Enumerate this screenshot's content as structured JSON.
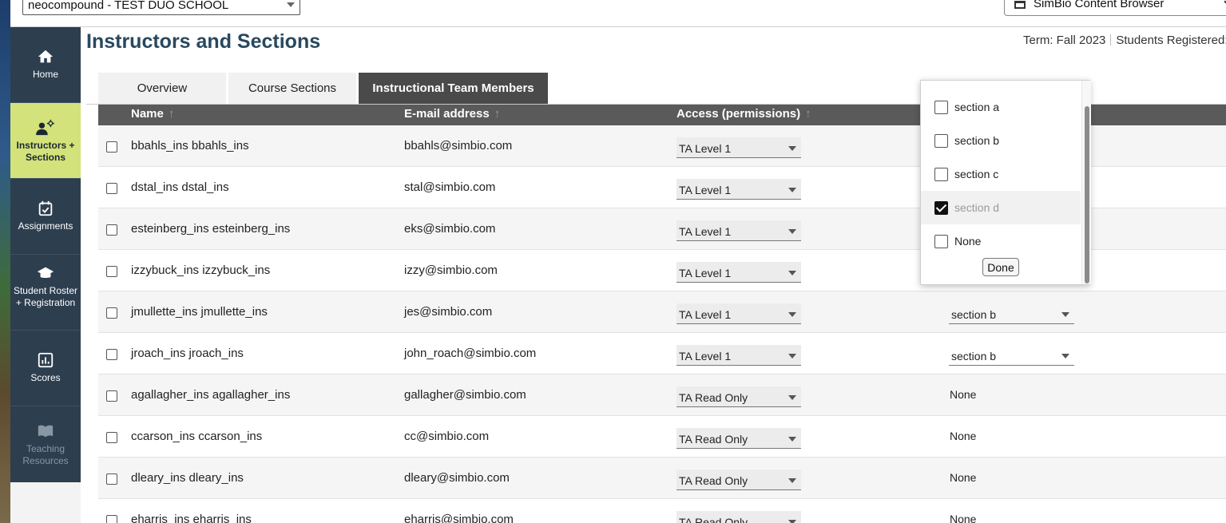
{
  "topbar": {
    "school": "neocompound - TEST DUO SCHOOL",
    "content_browser": "SimBio Content Browser"
  },
  "sidebar": {
    "items": [
      {
        "label": "Home",
        "icon": "home-icon"
      },
      {
        "label": "Instructors + Sections",
        "icon": "instructors-icon"
      },
      {
        "label": "Assignments",
        "icon": "calendar-check-icon"
      },
      {
        "label": "Student Roster + Registration",
        "icon": "graduation-cap-icon"
      },
      {
        "label": "Scores",
        "icon": "bar-chart-icon"
      },
      {
        "label": "Teaching Resources",
        "icon": "book-icon"
      }
    ]
  },
  "header": {
    "title": "Instructors and Sections",
    "term": "Term: Fall 2023",
    "students_registered": "Students Registered:"
  },
  "tabs": [
    {
      "label": "Overview"
    },
    {
      "label": "Course Sections"
    },
    {
      "label": "Instructional Team Members"
    }
  ],
  "table": {
    "columns": [
      "Name",
      "E-mail address",
      "Access (permissions)"
    ],
    "sort_arrow": "↑",
    "rows": [
      {
        "name": "bbahls_ins bbahls_ins",
        "email": "bbahls@simbio.com",
        "access": "TA Level 1",
        "section": ""
      },
      {
        "name": "dstal_ins dstal_ins",
        "email": "stal@simbio.com",
        "access": "TA Level 1",
        "section": ""
      },
      {
        "name": "esteinberg_ins esteinberg_ins",
        "email": "eks@simbio.com",
        "access": "TA Level 1",
        "section": ""
      },
      {
        "name": "izzybuck_ins izzybuck_ins",
        "email": "izzy@simbio.com",
        "access": "TA Level 1",
        "section": ""
      },
      {
        "name": "jmullette_ins jmullette_ins",
        "email": "jes@simbio.com",
        "access": "TA Level 1",
        "section": "section b"
      },
      {
        "name": "jroach_ins jroach_ins",
        "email": "john_roach@simbio.com",
        "access": "TA Level 1",
        "section": "section b"
      },
      {
        "name": "agallagher_ins agallagher_ins",
        "email": "gallagher@simbio.com",
        "access": "TA Read Only",
        "section": "None"
      },
      {
        "name": "ccarson_ins ccarson_ins",
        "email": "cc@simbio.com",
        "access": "TA Read Only",
        "section": "None"
      },
      {
        "name": "dleary_ins dleary_ins",
        "email": "dleary@simbio.com",
        "access": "TA Read Only",
        "section": "None"
      },
      {
        "name": "eharris_ins eharris_ins",
        "email": "eharris@simbio.com",
        "access": "TA Read Only",
        "section": "None"
      }
    ]
  },
  "section_popup": {
    "options": [
      {
        "label": "section a",
        "checked": false
      },
      {
        "label": "section b",
        "checked": false
      },
      {
        "label": "section c",
        "checked": false
      },
      {
        "label": "section d",
        "checked": true
      },
      {
        "label": "None",
        "checked": false
      }
    ],
    "done_label": "Done"
  }
}
